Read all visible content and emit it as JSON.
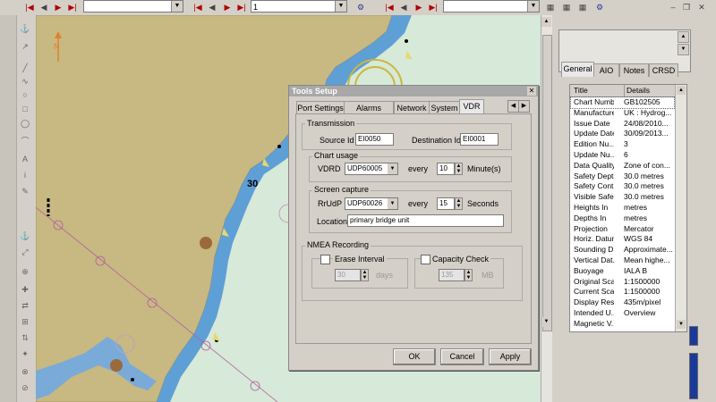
{
  "toolbar": {
    "combo1": "",
    "combo2": "1",
    "combo3": ""
  },
  "map": {
    "depth_label": "30"
  },
  "dialog": {
    "title": "Tools Setup",
    "tabs": [
      "Port Settings",
      "Alarms Priority",
      "Network",
      "System",
      "VDR"
    ],
    "active_tab": "VDR",
    "transmission": {
      "label": "Transmission",
      "source_label": "Source Id",
      "source_value": "EI0050",
      "dest_label": "Destination Id",
      "dest_value": "EI0001"
    },
    "chart_usage": {
      "label": "Chart usage",
      "vdrd_label": "VDRD",
      "vdrd_value": "UDP60005",
      "every_label": "every",
      "every_value": "10",
      "unit_label": "Minute(s)"
    },
    "screen_capture": {
      "label": "Screen capture",
      "rrudp_label": "RrUdP",
      "rrudp_value": "UDP60026",
      "every_label": "every",
      "every_value": "15",
      "unit_label": "Seconds",
      "location_label": "Location",
      "location_value": "primary bridge unit"
    },
    "nmea": {
      "label": "NMEA Recording",
      "erase_label": "Erase Interval",
      "erase_value": "30",
      "erase_unit": "days",
      "capacity_label": "Capacity Check",
      "capacity_value": "135",
      "capacity_unit": "MB"
    },
    "buttons": {
      "ok": "OK",
      "cancel": "Cancel",
      "apply": "Apply"
    }
  },
  "panel": {
    "tabs": [
      "General",
      "AIO",
      "Notes",
      "CRSD"
    ],
    "active_tab": "General",
    "col_title": "Title",
    "col_details": "Details",
    "rows": [
      [
        "Chart Number",
        "GB102505"
      ],
      [
        "Manufacturer",
        "UK : Hydrog..."
      ],
      [
        "Issue Date",
        "24/08/2010..."
      ],
      [
        "Update Date",
        "30/09/2013..."
      ],
      [
        "Edition Nu...",
        "3"
      ],
      [
        "Update Nu...",
        "6"
      ],
      [
        "Data Quality",
        "Zone of con..."
      ],
      [
        "Safety Depth",
        "30.0 metres"
      ],
      [
        "Safety Cont...",
        "30.0 metres"
      ],
      [
        "Visible Safe...",
        "30.0 metres"
      ],
      [
        "Heights In",
        "metres"
      ],
      [
        "Depths In",
        "metres"
      ],
      [
        "Projection",
        "Mercator"
      ],
      [
        "Horiz. Datum",
        "WGS 84"
      ],
      [
        "Sounding D...",
        "Approximate..."
      ],
      [
        "Vertical Dat...",
        "Mean highe..."
      ],
      [
        "Buoyage",
        "IALA B"
      ],
      [
        "Original Scale",
        "1:1500000"
      ],
      [
        "Current Scale",
        "1:1500000"
      ],
      [
        "Display Res...",
        "435m/pixel"
      ],
      [
        "Intended U...",
        "Overview"
      ],
      [
        "Magnetic V...",
        ""
      ]
    ]
  }
}
